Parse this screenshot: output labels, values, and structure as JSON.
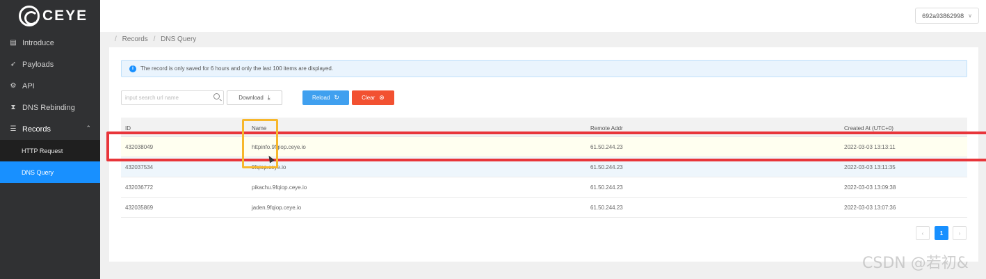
{
  "brand": {
    "name": "CEYE"
  },
  "sidebar": {
    "items": [
      {
        "label": "Introduce",
        "icon": "book-icon"
      },
      {
        "label": "Payloads",
        "icon": "rocket-icon"
      },
      {
        "label": "API",
        "icon": "api-icon"
      },
      {
        "label": "DNS Rebinding",
        "icon": "hourglass-icon"
      },
      {
        "label": "Records",
        "icon": "list-icon",
        "expanded": true
      }
    ],
    "sub_items": [
      {
        "label": "HTTP Request",
        "active": false
      },
      {
        "label": "DNS Query",
        "active": true
      }
    ]
  },
  "header": {
    "account": "692a93862998"
  },
  "breadcrumb": {
    "first": "Records",
    "second": "DNS Query",
    "separator": "/"
  },
  "alert": {
    "text": "The record is only saved for 6 hours and only the last 100 items are displayed."
  },
  "search": {
    "placeholder": "input search url name",
    "value": ""
  },
  "buttons": {
    "download": "Download",
    "reload": "Reload",
    "clear": "Clear"
  },
  "table": {
    "headers": {
      "id": "ID",
      "name": "Name",
      "remote": "Remote Addr",
      "created": "Created At (UTC+0)"
    },
    "rows": [
      {
        "id": "432038049",
        "name": "httpinfo.9fqiop.ceye.io",
        "remote": "61.50.244.23",
        "created": "2022-03-03 13:13:11"
      },
      {
        "id": "432037534",
        "name": "9fqiop.ceye.io",
        "remote": "61.50.244.23",
        "created": "2022-03-03 13:11:35"
      },
      {
        "id": "432036772",
        "name": "pikachu.9fqiop.ceye.io",
        "remote": "61.50.244.23",
        "created": "2022-03-03 13:09:38"
      },
      {
        "id": "432035869",
        "name": "jaden.9fqiop.ceye.io",
        "remote": "61.50.244.23",
        "created": "2022-03-03 13:07:36"
      }
    ]
  },
  "pagination": {
    "current": "1",
    "prev": "‹",
    "next": "›"
  },
  "watermark": "CSDN @若初&",
  "colors": {
    "primary": "#1890ff",
    "danger": "#f25131",
    "sidebar": "#303133",
    "annotation_red": "#e8353a",
    "annotation_orange": "#f7b72c"
  }
}
